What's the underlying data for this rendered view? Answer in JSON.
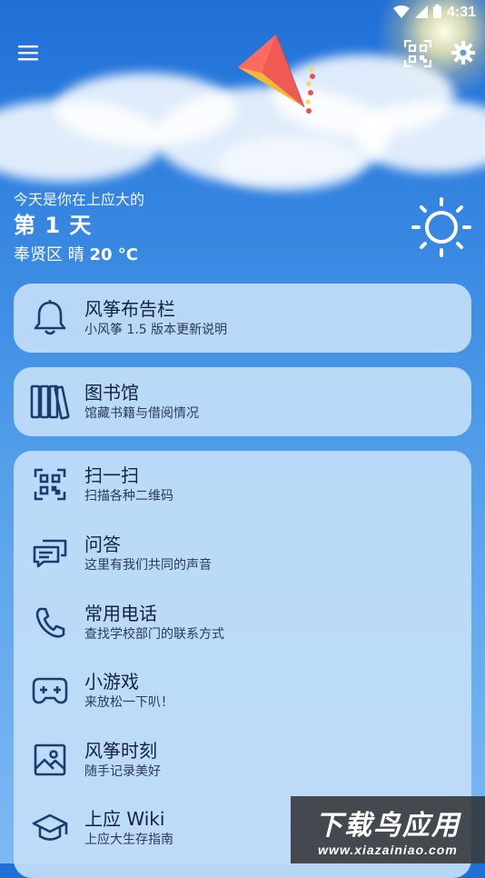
{
  "status_bar": {
    "time": "4:31",
    "icons": [
      "wifi-icon",
      "signal-icon",
      "battery-icon"
    ]
  },
  "header": {
    "menu_icon": "hamburger-menu-icon",
    "logo_icon": "kite-logo-icon",
    "scan_icon": "qr-scan-icon",
    "settings_icon": "gear-icon"
  },
  "greeting": {
    "line1": "今天是你在上应大的",
    "day_text": "第 1 天",
    "district": "奉贤区",
    "condition": "晴",
    "temperature": "20 °C",
    "weather_icon": "sunny-icon"
  },
  "cards": {
    "bulletin": {
      "title": "风筝布告栏",
      "subtitle": "小风筝 1.5 版本更新说明",
      "icon": "bell-icon"
    },
    "library": {
      "title": "图书馆",
      "subtitle": "馆藏书籍与借阅情况",
      "icon": "books-icon"
    },
    "tools": [
      {
        "title": "扫一扫",
        "subtitle": "扫描各种二维码",
        "icon": "qr-scan-icon"
      },
      {
        "title": "问答",
        "subtitle": "这里有我们共同的声音",
        "icon": "chat-bubbles-icon"
      },
      {
        "title": "常用电话",
        "subtitle": "查找学校部门的联系方式",
        "icon": "phone-icon"
      },
      {
        "title": "小游戏",
        "subtitle": "来放松一下叭！",
        "icon": "gamepad-icon"
      },
      {
        "title": "风筝时刻",
        "subtitle": "随手记录美好",
        "icon": "image-icon"
      },
      {
        "title": "上应 Wiki",
        "subtitle": "上应大生存指南",
        "icon": "graduation-cap-icon"
      }
    ]
  },
  "watermark": {
    "title": "下载鸟应用",
    "url": "www.xiazainiao.com"
  },
  "colors": {
    "sky_top": "#1f6fd8",
    "sky_bottom": "#7db9f2",
    "card_bg": "#c3def8",
    "icon_color": "#1c3c6e"
  }
}
